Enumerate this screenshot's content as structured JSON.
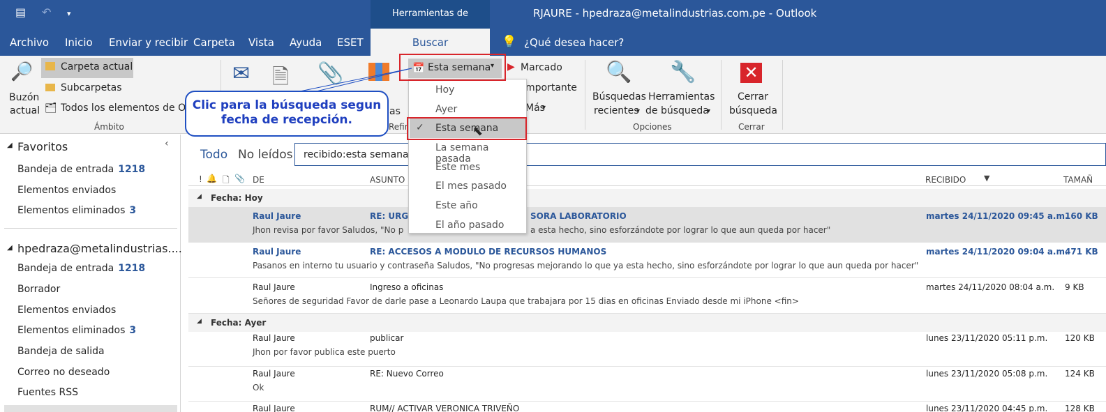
{
  "titlebar": {
    "tool_tab": "Herramientas de búsqueda",
    "title": "RJAURE - hpedraza@metalindustrias.com.pe  -  Outlook"
  },
  "menu": {
    "items": [
      "Archivo",
      "Inicio",
      "Enviar y recibir",
      "Carpeta",
      "Vista",
      "Ayuda",
      "ESET"
    ],
    "active": "Buscar",
    "tell_me": "¿Qué desea hacer?"
  },
  "ribbon": {
    "buzon": "Buzón",
    "actual": "actual",
    "carpeta_actual": "Carpeta actual",
    "subcarpetas": "Subcarpetas",
    "todos": "Todos los elementos de Ou",
    "ambito": "Ámbito",
    "esta_semana": "Esta semana",
    "marcado": "Marcado",
    "importante": "mportante",
    "mas": "Más",
    "as": "as",
    "refin": "Refin",
    "busquedas1": "Búsquedas",
    "busquedas2": "recientes",
    "herr1": "Herramientas",
    "herr2": "de búsqueda",
    "opciones": "Opciones",
    "cerrar1": "Cerrar",
    "cerrar2": "búsqueda",
    "cerrar": "Cerrar"
  },
  "callout": {
    "line1": "Clic para la búsqueda segun",
    "line2": "fecha de recepción."
  },
  "dropdown": [
    "Hoy",
    "Ayer",
    "Esta semana",
    "La semana pasada",
    "Este mes",
    "El mes pasado",
    "Este año",
    "El año pasado"
  ],
  "sidebar": {
    "favoritos": "Favoritos",
    "fav_items": [
      {
        "label": "Bandeja de entrada",
        "count": "1218"
      },
      {
        "label": "Elementos enviados",
        "count": ""
      },
      {
        "label": "Elementos eliminados",
        "count": "3"
      }
    ],
    "account": "hpedraza@metalindustrias....",
    "acc_items": [
      {
        "label": "Bandeja de entrada",
        "count": "1218"
      },
      {
        "label": "Borrador",
        "count": ""
      },
      {
        "label": "Elementos enviados",
        "count": ""
      },
      {
        "label": "Elementos eliminados",
        "count": "3"
      },
      {
        "label": "Bandeja de salida",
        "count": ""
      },
      {
        "label": "Correo no deseado",
        "count": ""
      },
      {
        "label": "Fuentes RSS",
        "count": ""
      }
    ]
  },
  "filter": {
    "todo": "Todo",
    "no_leidos": "No leídos",
    "search": "recibido:esta semana"
  },
  "columns": {
    "de": "DE",
    "asunto": "ASUNTO",
    "recibido": "RECIBIDO",
    "tamano": "TAMAÑ"
  },
  "groups": {
    "hoy": "Fecha: Hoy",
    "ayer": "Fecha: Ayer"
  },
  "emails": [
    {
      "from": "Raul Jaure",
      "subject": "RE: URGC",
      "subject2": "SORA LABORATORIO",
      "preview": "Jhon revisa por favor  Saludos,  \"No p",
      "preview2": "a esta hecho, sino esforzándote por lograr lo que aun queda por hacer\"",
      "date": "martes 24/11/2020 09:45 a.m.",
      "size": "160 KB"
    },
    {
      "from": "Raul Jaure",
      "subject": "RE: ACCESOS A MODULO DE RECURSOS HUMANOS",
      "preview": "Pasanos en interno tu usuario y contraseña  Saludos,  \"No progresas mejorando lo que ya esta hecho, sino esforzándote por lograr lo que aun queda por hacer\"",
      "date": "martes 24/11/2020 09:04 a.m.",
      "size": "471 KB"
    },
    {
      "from": "Raul Jaure",
      "subject": "Ingreso a oficinas",
      "preview": "Señores de seguridad  Favor de darle pase a Leonardo Laupa que trabajara por 15 dias en oficinas  Enviado desde mi iPhone <fin>",
      "date": "martes 24/11/2020 08:04 a.m.",
      "size": "9 KB"
    },
    {
      "from": "Raul Jaure",
      "subject": "publicar",
      "preview": "Jhon por favor publica este puerto",
      "date": "lunes 23/11/2020 05:11 p.m.",
      "size": "120 KB"
    },
    {
      "from": "Raul Jaure",
      "subject": "RE: Nuevo Correo",
      "preview": "Ok",
      "date": "lunes 23/11/2020 05:08 p.m.",
      "size": "124 KB"
    },
    {
      "from": "Raul Jaure",
      "subject": "RUM// ACTIVAR VERONICA TRIVEÑO",
      "date": "lunes 23/11/2020 04:45 p.m.",
      "size": "128 KB"
    }
  ]
}
